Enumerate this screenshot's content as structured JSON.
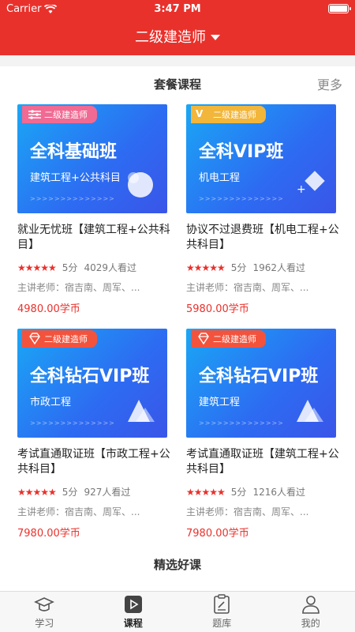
{
  "status": {
    "carrier": "Carrier",
    "time": "3:47 PM"
  },
  "header": {
    "title": "二级建造师"
  },
  "section1": {
    "title": "套餐课程",
    "more": "更多"
  },
  "courses": [
    {
      "tag": "二级建造师",
      "tag_color": "#f06a93",
      "banner_title": "全科基础班",
      "banner_sub": "建筑工程+公共科目",
      "name": "就业无忧班【建筑工程+公共科目】",
      "score": "5分",
      "views": "4029人看过",
      "teacher": "主讲老师：宿吉南、周军、...",
      "price": "4980.00学币"
    },
    {
      "tag": "二级建造师",
      "tag_color": "#f2b63a",
      "banner_title": "全科VIP班",
      "banner_sub": "机电工程",
      "name": "协议不过退费班【机电工程+公共科目】",
      "score": "5分",
      "views": "1962人看过",
      "teacher": "主讲老师：宿吉南、周军、...",
      "price": "5980.00学币"
    },
    {
      "tag": "二级建造师",
      "tag_color": "#f3533d",
      "banner_title": "全科钻石VIP班",
      "banner_sub": "市政工程",
      "name": "考试直通取证班【市政工程+公共科目】",
      "score": "5分",
      "views": "927人看过",
      "teacher": "主讲老师：宿吉南、周军、...",
      "price": "7980.00学币"
    },
    {
      "tag": "二级建造师",
      "tag_color": "#f3533d",
      "banner_title": "全科钻石VIP班",
      "banner_sub": "建筑工程",
      "name": "考试直通取证班【建筑工程+公共科目】",
      "score": "5分",
      "views": "1216人看过",
      "teacher": "主讲老师：宿吉南、周军、...",
      "price": "7980.00学币"
    }
  ],
  "section2": {
    "title": "精选好课"
  },
  "tabs": [
    {
      "label": "学习",
      "icon": "graduation-cap-icon"
    },
    {
      "label": "课程",
      "icon": "play-icon",
      "active": true
    },
    {
      "label": "题库",
      "icon": "clipboard-icon"
    },
    {
      "label": "我的",
      "icon": "user-icon"
    }
  ],
  "colors": {
    "brand": "#e9312c"
  }
}
